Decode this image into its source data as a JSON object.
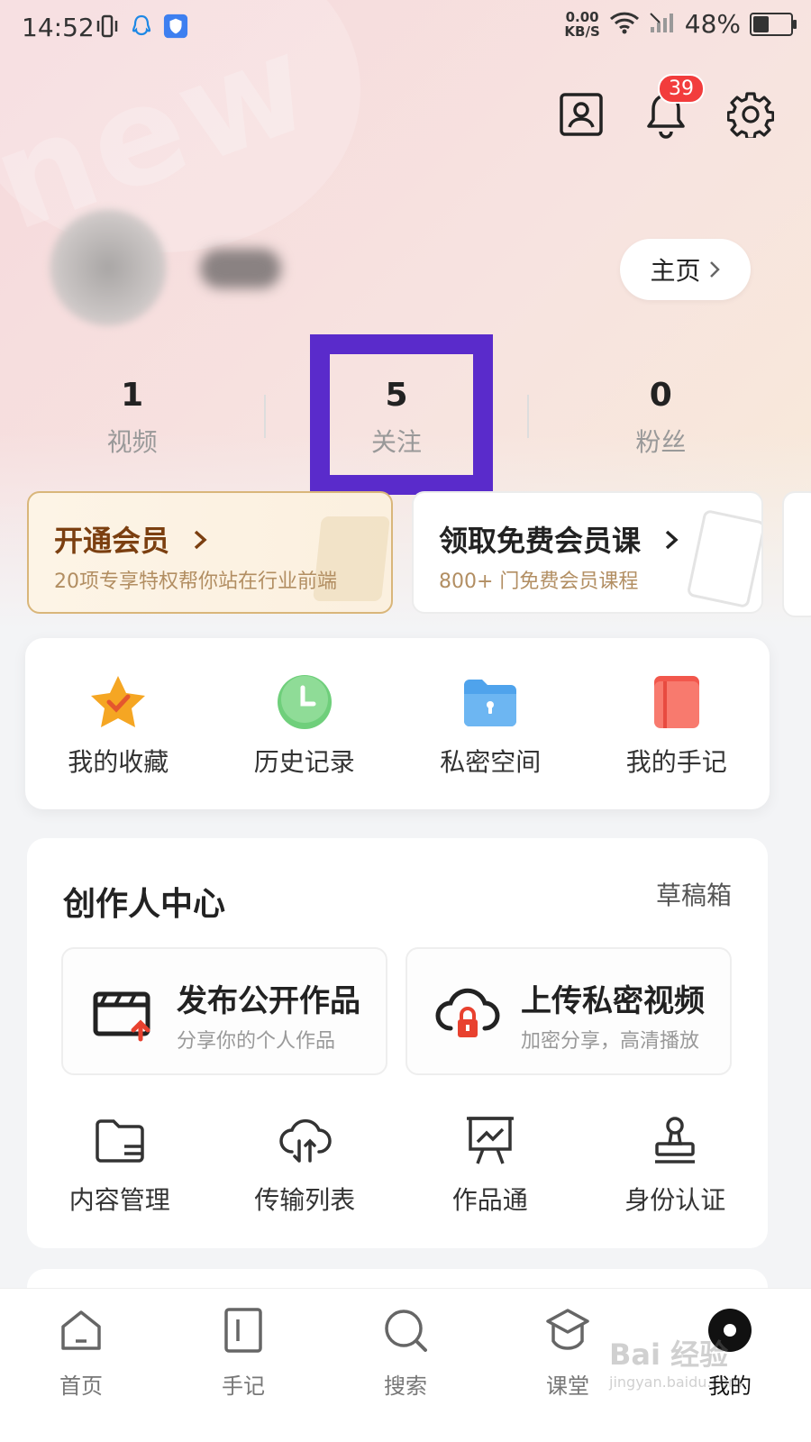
{
  "status_bar": {
    "time": "14:52",
    "net_speed_value": "0.00",
    "net_speed_unit": "KB/S",
    "battery": "48%",
    "battery_level": 0.48
  },
  "top_actions": {
    "notification_count": "39"
  },
  "profile": {
    "homepage_label": "主页"
  },
  "stats": [
    {
      "value": "1",
      "label": "视频"
    },
    {
      "value": "5",
      "label": "关注"
    },
    {
      "value": "0",
      "label": "粉丝"
    }
  ],
  "member": {
    "vip_title": "开通会员",
    "vip_subtitle": "20项专享特权帮你站在行业前端",
    "free_title": "领取免费会员课",
    "free_subtitle": "800+ 门免费会员课程"
  },
  "quick": [
    {
      "label": "我的收藏",
      "icon": "star-icon"
    },
    {
      "label": "历史记录",
      "icon": "clock-icon"
    },
    {
      "label": "私密空间",
      "icon": "lock-folder-icon"
    },
    {
      "label": "我的手记",
      "icon": "notebook-icon"
    }
  ],
  "creator": {
    "title": "创作人中心",
    "drafts_label": "草稿箱",
    "publish_title": "发布公开作品",
    "publish_subtitle": "分享你的个人作品",
    "upload_title": "上传私密视频",
    "upload_subtitle": "加密分享，高清播放",
    "tools": [
      {
        "label": "内容管理",
        "icon": "folder-icon"
      },
      {
        "label": "传输列表",
        "icon": "cloud-transfer-icon"
      },
      {
        "label": "作品通",
        "icon": "presentation-chart-icon"
      },
      {
        "label": "身份认证",
        "icon": "stamp-icon"
      }
    ]
  },
  "nav": [
    {
      "label": "首页",
      "icon": "home-icon"
    },
    {
      "label": "手记",
      "icon": "note-icon"
    },
    {
      "label": "搜索",
      "icon": "search-icon"
    },
    {
      "label": "课堂",
      "icon": "classroom-icon"
    },
    {
      "label": "我的",
      "icon": "profile-dot-icon"
    }
  ],
  "watermark": {
    "main": "Bai 经验",
    "sub": "jingyan.baidu.com"
  },
  "colors": {
    "highlight": "#5a2bcb",
    "badge": "#f23c3c",
    "vip_text": "#7b3f10"
  }
}
